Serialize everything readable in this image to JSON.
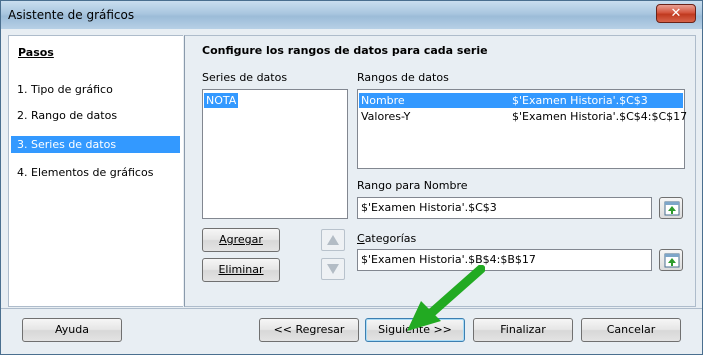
{
  "window": {
    "title": "Asistente de gráficos",
    "close_label": "✕"
  },
  "sidebar": {
    "heading": "Pasos",
    "steps": [
      {
        "label": "1. Tipo de gráfico"
      },
      {
        "label": "2. Rango de datos"
      },
      {
        "label": "3. Series de datos"
      },
      {
        "label": "4. Elementos de gráficos"
      }
    ],
    "active_index": 2
  },
  "main": {
    "title": "Configure los rangos de datos para cada serie",
    "series_label": "Series de datos",
    "series": [
      "NOTA"
    ],
    "ranges_label": "Rangos de datos",
    "ranges": [
      {
        "name": "Nombre",
        "value": "$'Examen Historia'.$C$3"
      },
      {
        "name": "Valores-Y",
        "value": "$'Examen Historia'.$C$4:$C$17"
      }
    ],
    "add_label": "Agregar",
    "remove_label": "Eliminar",
    "name_range_label": "Rango para Nombre",
    "name_range_value": "$'Examen Historia'.$C$3",
    "categories_label": "Categorías",
    "categories_value": "$'Examen Historia'.$B$4:$B$17"
  },
  "footer": {
    "help_label": "Ayuda",
    "back_label": "<< Regresar",
    "next_label": "Siguiente >>",
    "finish_label": "Finalizar",
    "cancel_label": "Cancelar"
  },
  "colors": {
    "selection": "#3399ff",
    "annotation_arrow": "#22aa22"
  }
}
